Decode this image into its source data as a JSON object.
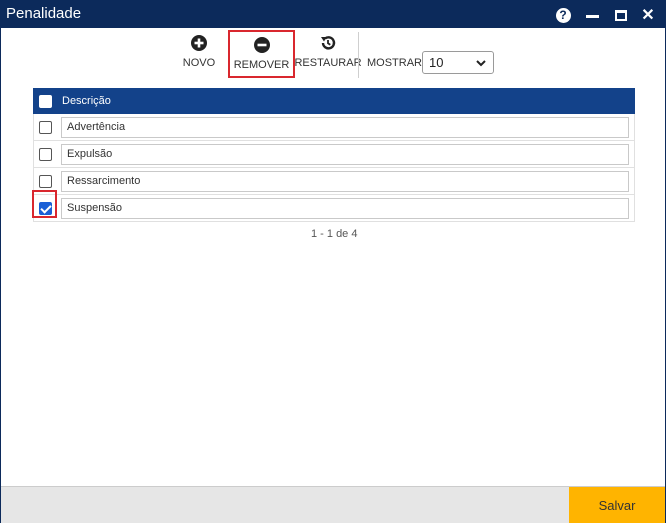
{
  "window": {
    "title": "Penalidade"
  },
  "toolbar": {
    "novo_label": "NOVO",
    "remover_label": "REMOVER",
    "restaurar_label": "RESTAURAR",
    "mostrar_label": "MOSTRAR:",
    "mostrar_value": "10"
  },
  "grid": {
    "header": "Descrição",
    "rows": [
      {
        "label": "Advertência",
        "checked": false
      },
      {
        "label": "Expulsão",
        "checked": false
      },
      {
        "label": "Ressarcimento",
        "checked": false
      },
      {
        "label": "Suspensão",
        "checked": true
      }
    ],
    "pager": "1 - 1 de 4"
  },
  "footer": {
    "save_label": "Salvar"
  },
  "colors": {
    "titlebar": "#0c2a5b",
    "header": "#13428a",
    "accent": "#ffb400",
    "highlight": "#d9272e"
  }
}
